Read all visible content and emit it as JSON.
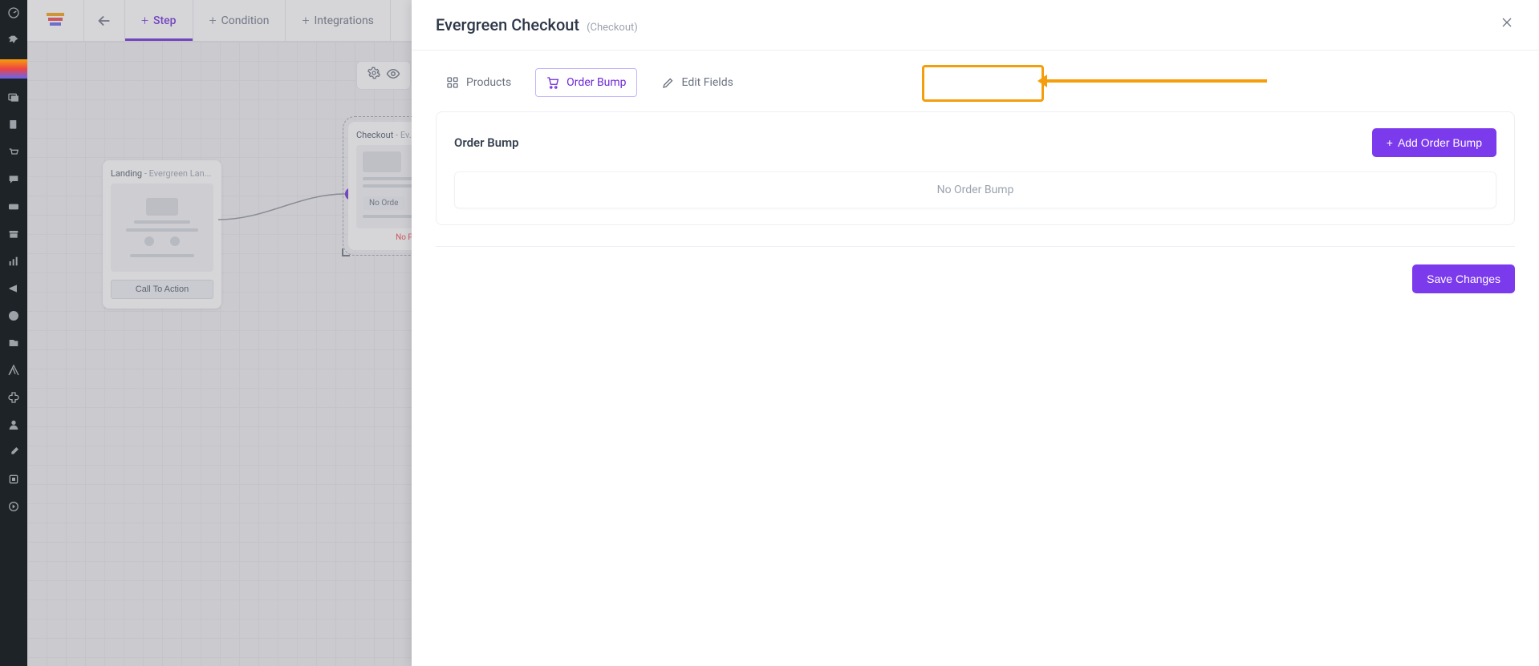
{
  "toolbar": {
    "tabs": [
      {
        "label": "Step"
      },
      {
        "label": "Condition"
      },
      {
        "label": "Integrations"
      }
    ]
  },
  "canvas": {
    "landing": {
      "title": "Landing",
      "subtitle": " - Evergreen Lan...",
      "cta_label": "Call To Action"
    },
    "checkout": {
      "title": "Checkout",
      "subtitle": " - Ev...",
      "chip": "No Orde",
      "warn": "No Produ"
    }
  },
  "drawer": {
    "title": "Evergreen Checkout",
    "type": "(Checkout)",
    "tabs": {
      "products": "Products",
      "order_bump": "Order Bump",
      "edit_fields": "Edit Fields"
    },
    "section": {
      "heading": "Order Bump",
      "add_btn": "Add Order Bump",
      "empty": "No Order Bump"
    },
    "save_btn": "Save Changes"
  },
  "colors": {
    "primary": "#7c3aed",
    "annotation": "#f59e0b"
  }
}
